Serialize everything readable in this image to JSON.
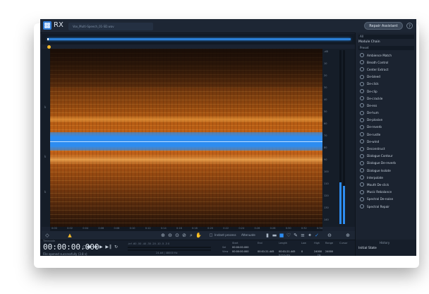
{
  "app": {
    "logo_text": "RX",
    "file_tab": "Vox_Multi-Speech_01-SD.wav",
    "assistant_button": "Repair Assistant",
    "help_glyph": "?"
  },
  "spectrogram": {
    "left_axis": [
      "k",
      "k",
      "k"
    ],
    "time_ruler": [
      "0:00",
      "0:02",
      "0:04",
      "0:06",
      "0:08",
      "0:10",
      "0:12",
      "0:14",
      "0:16",
      "0:18",
      "0:20",
      "0:22",
      "0:24",
      "0:26",
      "0:28",
      "0:30",
      "0:32",
      "0:34"
    ],
    "right_ticks": [
      "-dB",
      "10",
      "20",
      "30",
      "40",
      "50",
      "60",
      "70",
      "80",
      "90",
      "100",
      "110",
      "120",
      "130",
      "140"
    ],
    "meter_level": 0.24
  },
  "toolbar": {
    "instant_process_label": "Instant process",
    "attenuate_label": "Attenuate"
  },
  "status": {
    "timecode_label": "Timecode",
    "timecode": "00:00:00.000",
    "message": "File opened successfully (3.8 s)",
    "transport": "○● ◀ ▶ ▶‖ ↻",
    "level_scale": "-inf  -60  -50  -40  -30  -20  -10  -5  -3  0",
    "bit_info": "24-bit | 48000 Hz"
  },
  "selection": {
    "headers": [
      "Start",
      "End",
      "Length",
      "Low",
      "High",
      "Range",
      "Cursor"
    ],
    "sel_label": "Sel",
    "view_label": "View",
    "sel_values": [
      "00:00:00.000",
      "",
      "",
      "",
      "",
      "",
      ""
    ],
    "view_values": [
      "00:00:00.000",
      "00:01:21.445",
      "00:01:21.445",
      "0",
      "24000",
      "24000",
      ""
    ],
    "time_format": "h:m:s.ms",
    "hz": "Hz"
  },
  "panel": {
    "filter_label": "All",
    "module_chain": "Module Chain",
    "preset": "Preset",
    "modules": [
      {
        "label": "Ambience Match",
        "icon": "ambience-icon"
      },
      {
        "label": "Breath Control",
        "icon": "breath-icon"
      },
      {
        "label": "Center Extract",
        "icon": "center-icon"
      },
      {
        "label": "De-bleed",
        "icon": "debleed-icon"
      },
      {
        "label": "De-click",
        "icon": "declick-icon"
      },
      {
        "label": "De-clip",
        "icon": "declip-icon"
      },
      {
        "label": "De-crackle",
        "icon": "decrackle-icon"
      },
      {
        "label": "De-ess",
        "icon": "deess-icon"
      },
      {
        "label": "De-hum",
        "icon": "dehum-icon"
      },
      {
        "label": "De-plosive",
        "icon": "deplosive-icon"
      },
      {
        "label": "De-reverb",
        "icon": "dereverb-icon"
      },
      {
        "label": "De-rustle",
        "icon": "derustle-icon"
      },
      {
        "label": "De-wind",
        "icon": "dewind-icon"
      },
      {
        "label": "Deconstruct",
        "icon": "deconstruct-icon"
      },
      {
        "label": "Dialogue Contour",
        "icon": "contour-icon"
      },
      {
        "label": "Dialogue De-reverb",
        "icon": "dialogue-dereverb-icon"
      },
      {
        "label": "Dialogue Isolate",
        "icon": "isolate-icon"
      },
      {
        "label": "Interpolate",
        "icon": "interpolate-icon"
      },
      {
        "label": "Mouth De-click",
        "icon": "mouth-icon"
      },
      {
        "label": "Music Rebalance",
        "icon": "rebalance-icon"
      },
      {
        "label": "Spectral De-noise",
        "icon": "denoise-icon"
      },
      {
        "label": "Spectral Repair",
        "icon": "repair-icon"
      }
    ],
    "history_label": "History",
    "history_item": "Initial State"
  }
}
